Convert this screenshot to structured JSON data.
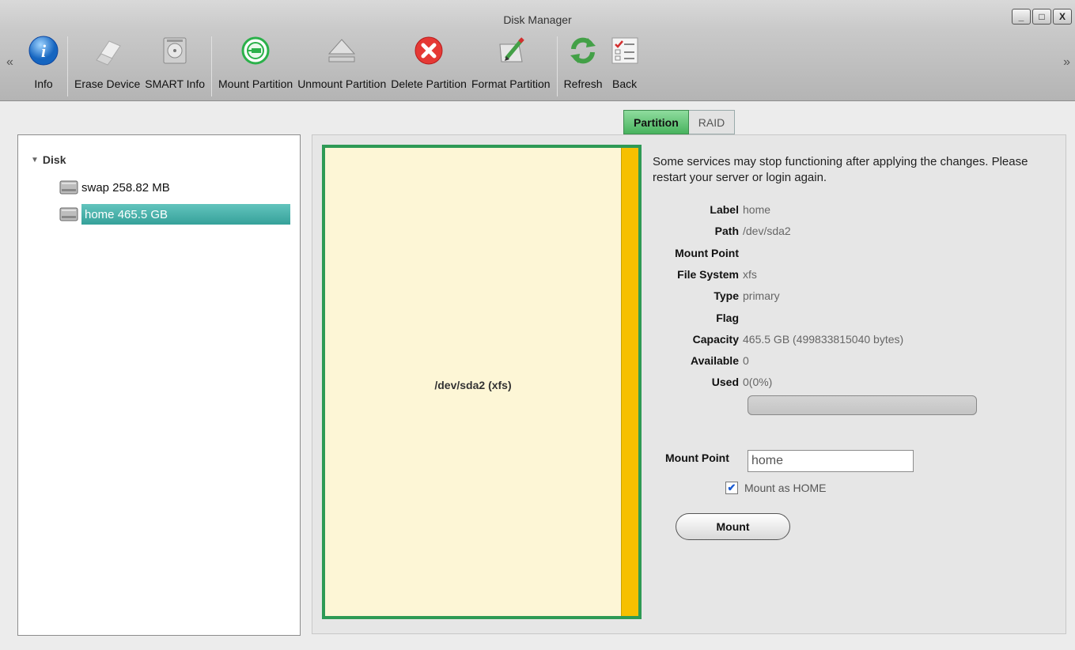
{
  "window": {
    "title": "Disk Manager",
    "controls": {
      "minimize": "_",
      "maximize": "□",
      "close": "X"
    },
    "nav_left": "«",
    "nav_right": "»"
  },
  "toolbar": {
    "items": [
      {
        "label": "Info",
        "icon": "info-icon"
      },
      {
        "label": "Erase Device",
        "icon": "eraser-icon"
      },
      {
        "label": "SMART Info",
        "icon": "hard-drive-icon"
      },
      {
        "label": "Mount Partition",
        "icon": "plug-icon"
      },
      {
        "label": "Unmount Partition",
        "icon": "eject-icon"
      },
      {
        "label": "Delete Partition",
        "icon": "delete-icon"
      },
      {
        "label": "Format Partition",
        "icon": "edit-icon"
      },
      {
        "label": "Refresh",
        "icon": "refresh-icon"
      },
      {
        "label": "Back",
        "icon": "checklist-icon"
      }
    ]
  },
  "tabs": {
    "partition": "Partition",
    "raid": "RAID",
    "active": "Partition"
  },
  "tree": {
    "root": "Disk",
    "items": [
      {
        "label": "swap 258.82 MB"
      },
      {
        "label": "home 465.5 GB",
        "selected": true
      }
    ]
  },
  "partition_map": {
    "label": "/dev/sda2 (xfs)",
    "colors": {
      "border": "#2e9a55",
      "free": "#fdf6d6",
      "used": "#f6c000"
    }
  },
  "details": {
    "notice": "Some services may stop functioning after applying the changes. Please restart your server or login again.",
    "label_key": "Label",
    "label_val": "home",
    "path_key": "Path",
    "path_val": "/dev/sda2",
    "mount_point_key": "Mount Point",
    "mount_point_val": "",
    "fs_key": "File System",
    "fs_val": "xfs",
    "type_key": "Type",
    "type_val": "primary",
    "flag_key": "Flag",
    "flag_val": "",
    "capacity_key": "Capacity",
    "capacity_val": "465.5 GB (499833815040 bytes)",
    "available_key": "Available",
    "available_val": "0",
    "used_key": "Used",
    "used_val": "0(0%)",
    "used_fraction": 0
  },
  "mount_form": {
    "label": "Mount Point",
    "value": "home",
    "checkbox_label": "Mount as HOME",
    "checkbox_checked": true,
    "checkbox_mark": "✔",
    "button": "Mount"
  }
}
